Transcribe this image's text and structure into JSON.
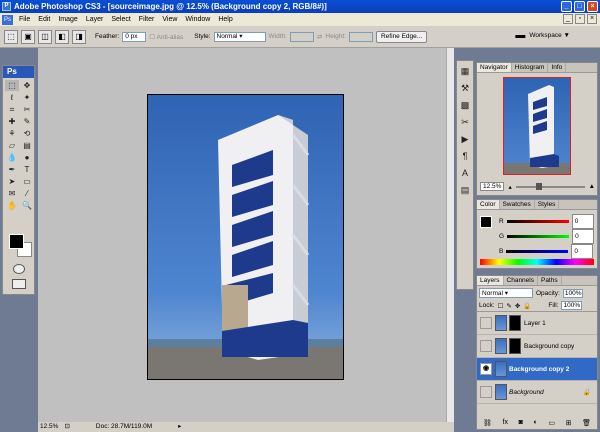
{
  "titlebar": {
    "text": "Adobe Photoshop CS3 - [sourceimage.jpg @ 12.5% (Background copy 2, RGB/8#)]"
  },
  "menu": [
    "File",
    "Edit",
    "Image",
    "Layer",
    "Select",
    "Filter",
    "View",
    "Window",
    "Help"
  ],
  "options": {
    "feather_label": "Feather:",
    "feather_value": "0 px",
    "antialias": "Anti-alias",
    "style_label": "Style:",
    "style_value": "Normal",
    "width_label": "Width:",
    "height_label": "Height:",
    "refine": "Refine Edge...",
    "workspace": "Workspace ▼"
  },
  "toolbox": {
    "logo": "Ps"
  },
  "status": {
    "zoom": "12.5%",
    "doc": "Doc: 28.7M/119.0M"
  },
  "navigator": {
    "tabs": [
      "Navigator",
      "Histogram",
      "Info"
    ],
    "zoom": "12.5%"
  },
  "color": {
    "tabs": [
      "Color",
      "Swatches",
      "Styles"
    ],
    "r_label": "R",
    "g_label": "G",
    "b_label": "B",
    "r": "0",
    "g": "0",
    "b": "0"
  },
  "layers": {
    "tabs": [
      "Layers",
      "Channels",
      "Paths"
    ],
    "blend": "Normal",
    "opacity_label": "Opacity:",
    "opacity": "100%",
    "lock_label": "Lock:",
    "fill_label": "Fill:",
    "fill": "100%",
    "items": [
      {
        "name": "Layer 1"
      },
      {
        "name": "Background copy"
      },
      {
        "name": "Background copy 2"
      },
      {
        "name": "Background"
      }
    ]
  }
}
